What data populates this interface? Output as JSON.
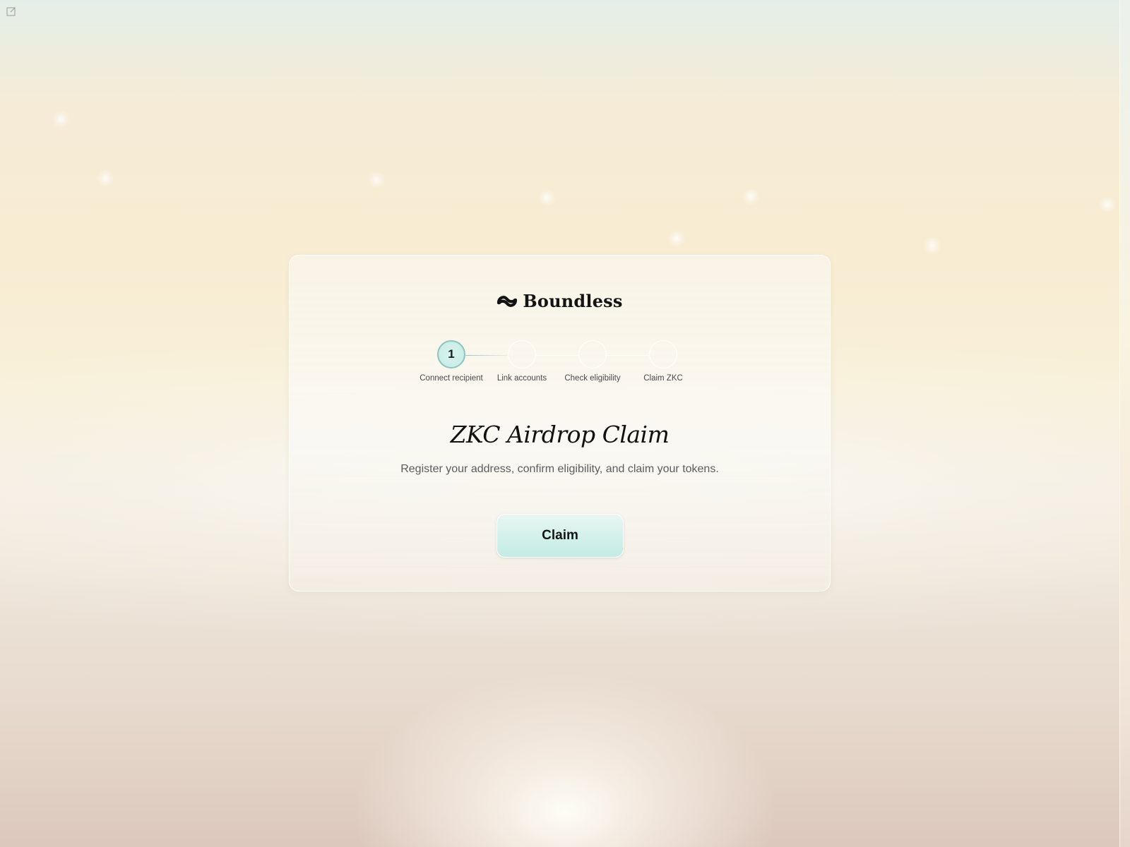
{
  "brand": {
    "name": "Boundless",
    "logo_icon": "boundless-logo-icon"
  },
  "stepper": {
    "current_step": 1,
    "steps": [
      {
        "number": "1",
        "label": "Connect recipient",
        "active": true
      },
      {
        "number": "",
        "label": "Link accounts",
        "active": false
      },
      {
        "number": "",
        "label": "Check eligibility",
        "active": false
      },
      {
        "number": "",
        "label": "Claim ZKC",
        "active": false
      }
    ]
  },
  "main": {
    "title": "ZKC Airdrop Claim",
    "subtitle": "Register your address, confirm eligibility, and claim your tokens.",
    "claim_label": "Claim"
  },
  "colors": {
    "accent": "#c6ebe6",
    "accent_border": "#8cc5c0",
    "text_primary": "#111111",
    "text_secondary": "#5c5c5c"
  },
  "icons": {
    "popout": "external-link-icon"
  }
}
